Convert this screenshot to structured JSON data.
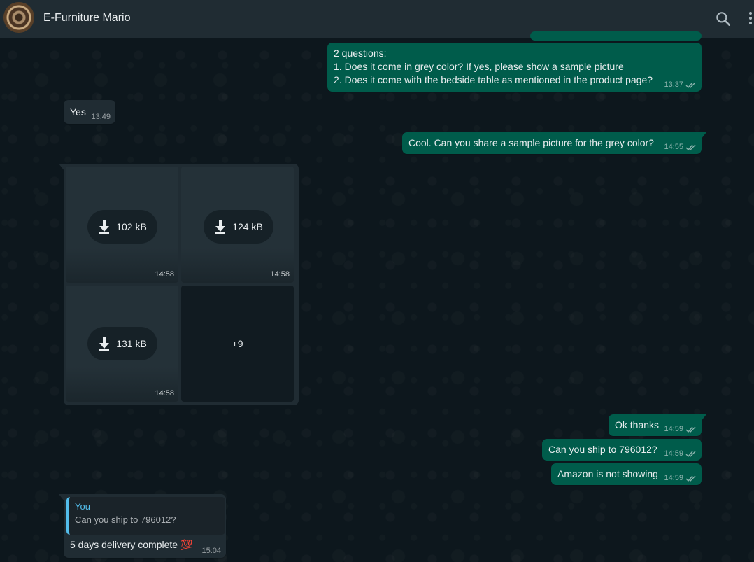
{
  "header": {
    "contact_name": "E-Furniture Mario",
    "icons": [
      "avatar",
      "search-icon",
      "menu-icon"
    ]
  },
  "messages": [
    {
      "direction": "outgoing",
      "lines": [
        "2 questions:",
        "1. Does it come in grey color? If yes, please show a sample picture",
        "2. Does it come with the bedside table as mentioned in the product page?"
      ],
      "time": "13:37",
      "status": "read"
    },
    {
      "direction": "incoming",
      "text": "Yes",
      "time": "13:49"
    },
    {
      "direction": "outgoing",
      "text": "Cool. Can you share a sample picture for the grey color?",
      "time": "14:55",
      "status": "read"
    },
    {
      "direction": "incoming",
      "media_album": {
        "items": [
          {
            "size": "102 kB",
            "time": "14:58"
          },
          {
            "size": "124 kB",
            "time": "14:58"
          },
          {
            "size": "131 kB",
            "time": "14:58"
          }
        ],
        "more_count": "+9"
      }
    },
    {
      "direction": "outgoing",
      "text": "Ok thanks",
      "time": "14:59",
      "status": "read"
    },
    {
      "direction": "outgoing",
      "text": "Can you ship to 796012?",
      "time": "14:59",
      "status": "read"
    },
    {
      "direction": "outgoing",
      "text": "Amazon is not showing",
      "time": "14:59",
      "status": "read"
    },
    {
      "direction": "incoming",
      "quoted": {
        "author": "You",
        "text": "Can you ship to 796012?"
      },
      "text": "5 days delivery complete 💯",
      "time": "15:04"
    }
  ],
  "colors": {
    "outgoing_bubble": "#005c4b",
    "incoming_bubble": "#202c33",
    "header": "#202c33",
    "quote_accent": "#53bdeb"
  }
}
